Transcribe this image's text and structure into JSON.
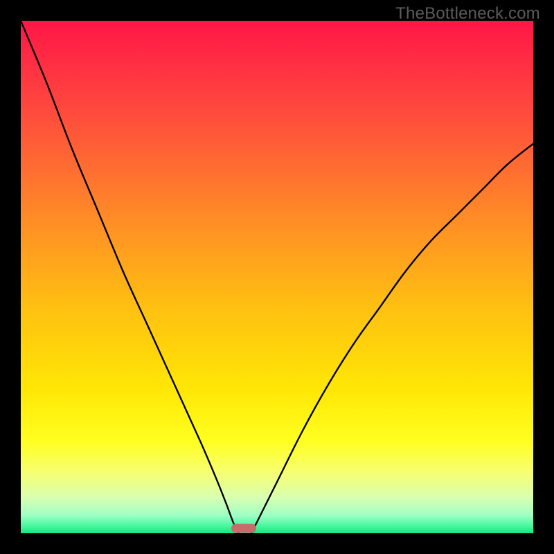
{
  "watermark": {
    "text": "TheBottleneck.com"
  },
  "colors": {
    "black": "#000000",
    "marker": "#c96a6d",
    "curve": "#000000",
    "gradient_stops": [
      {
        "offset": 0.0,
        "color": "#ff1647"
      },
      {
        "offset": 0.18,
        "color": "#ff4b3d"
      },
      {
        "offset": 0.38,
        "color": "#ff8a27"
      },
      {
        "offset": 0.56,
        "color": "#ffc011"
      },
      {
        "offset": 0.72,
        "color": "#ffe705"
      },
      {
        "offset": 0.82,
        "color": "#ffff20"
      },
      {
        "offset": 0.88,
        "color": "#f7ff70"
      },
      {
        "offset": 0.93,
        "color": "#d9ffb0"
      },
      {
        "offset": 0.965,
        "color": "#9fffc5"
      },
      {
        "offset": 0.985,
        "color": "#4bf7a0"
      },
      {
        "offset": 1.0,
        "color": "#15e880"
      }
    ]
  },
  "chart_data": {
    "type": "line",
    "title": "",
    "xlabel": "",
    "ylabel": "",
    "xlim": [
      0,
      100
    ],
    "ylim": [
      0,
      100
    ],
    "legend": false,
    "grid": false,
    "series": [
      {
        "name": "left-branch",
        "x": [
          0,
          5,
          10,
          15,
          20,
          25,
          30,
          35,
          38,
          40,
          41.5,
          42.5
        ],
        "y": [
          100,
          88,
          75,
          63,
          51,
          40,
          29,
          18,
          11,
          6,
          2,
          0
        ]
      },
      {
        "name": "right-branch",
        "x": [
          45,
          47,
          50,
          55,
          60,
          65,
          70,
          75,
          80,
          85,
          90,
          95,
          100
        ],
        "y": [
          0,
          4,
          10,
          20,
          29,
          37,
          44,
          51,
          57,
          62,
          67,
          72,
          76
        ]
      }
    ],
    "marker": {
      "x": 43.5,
      "y": 1.0,
      "color": "#c96a6d"
    }
  }
}
